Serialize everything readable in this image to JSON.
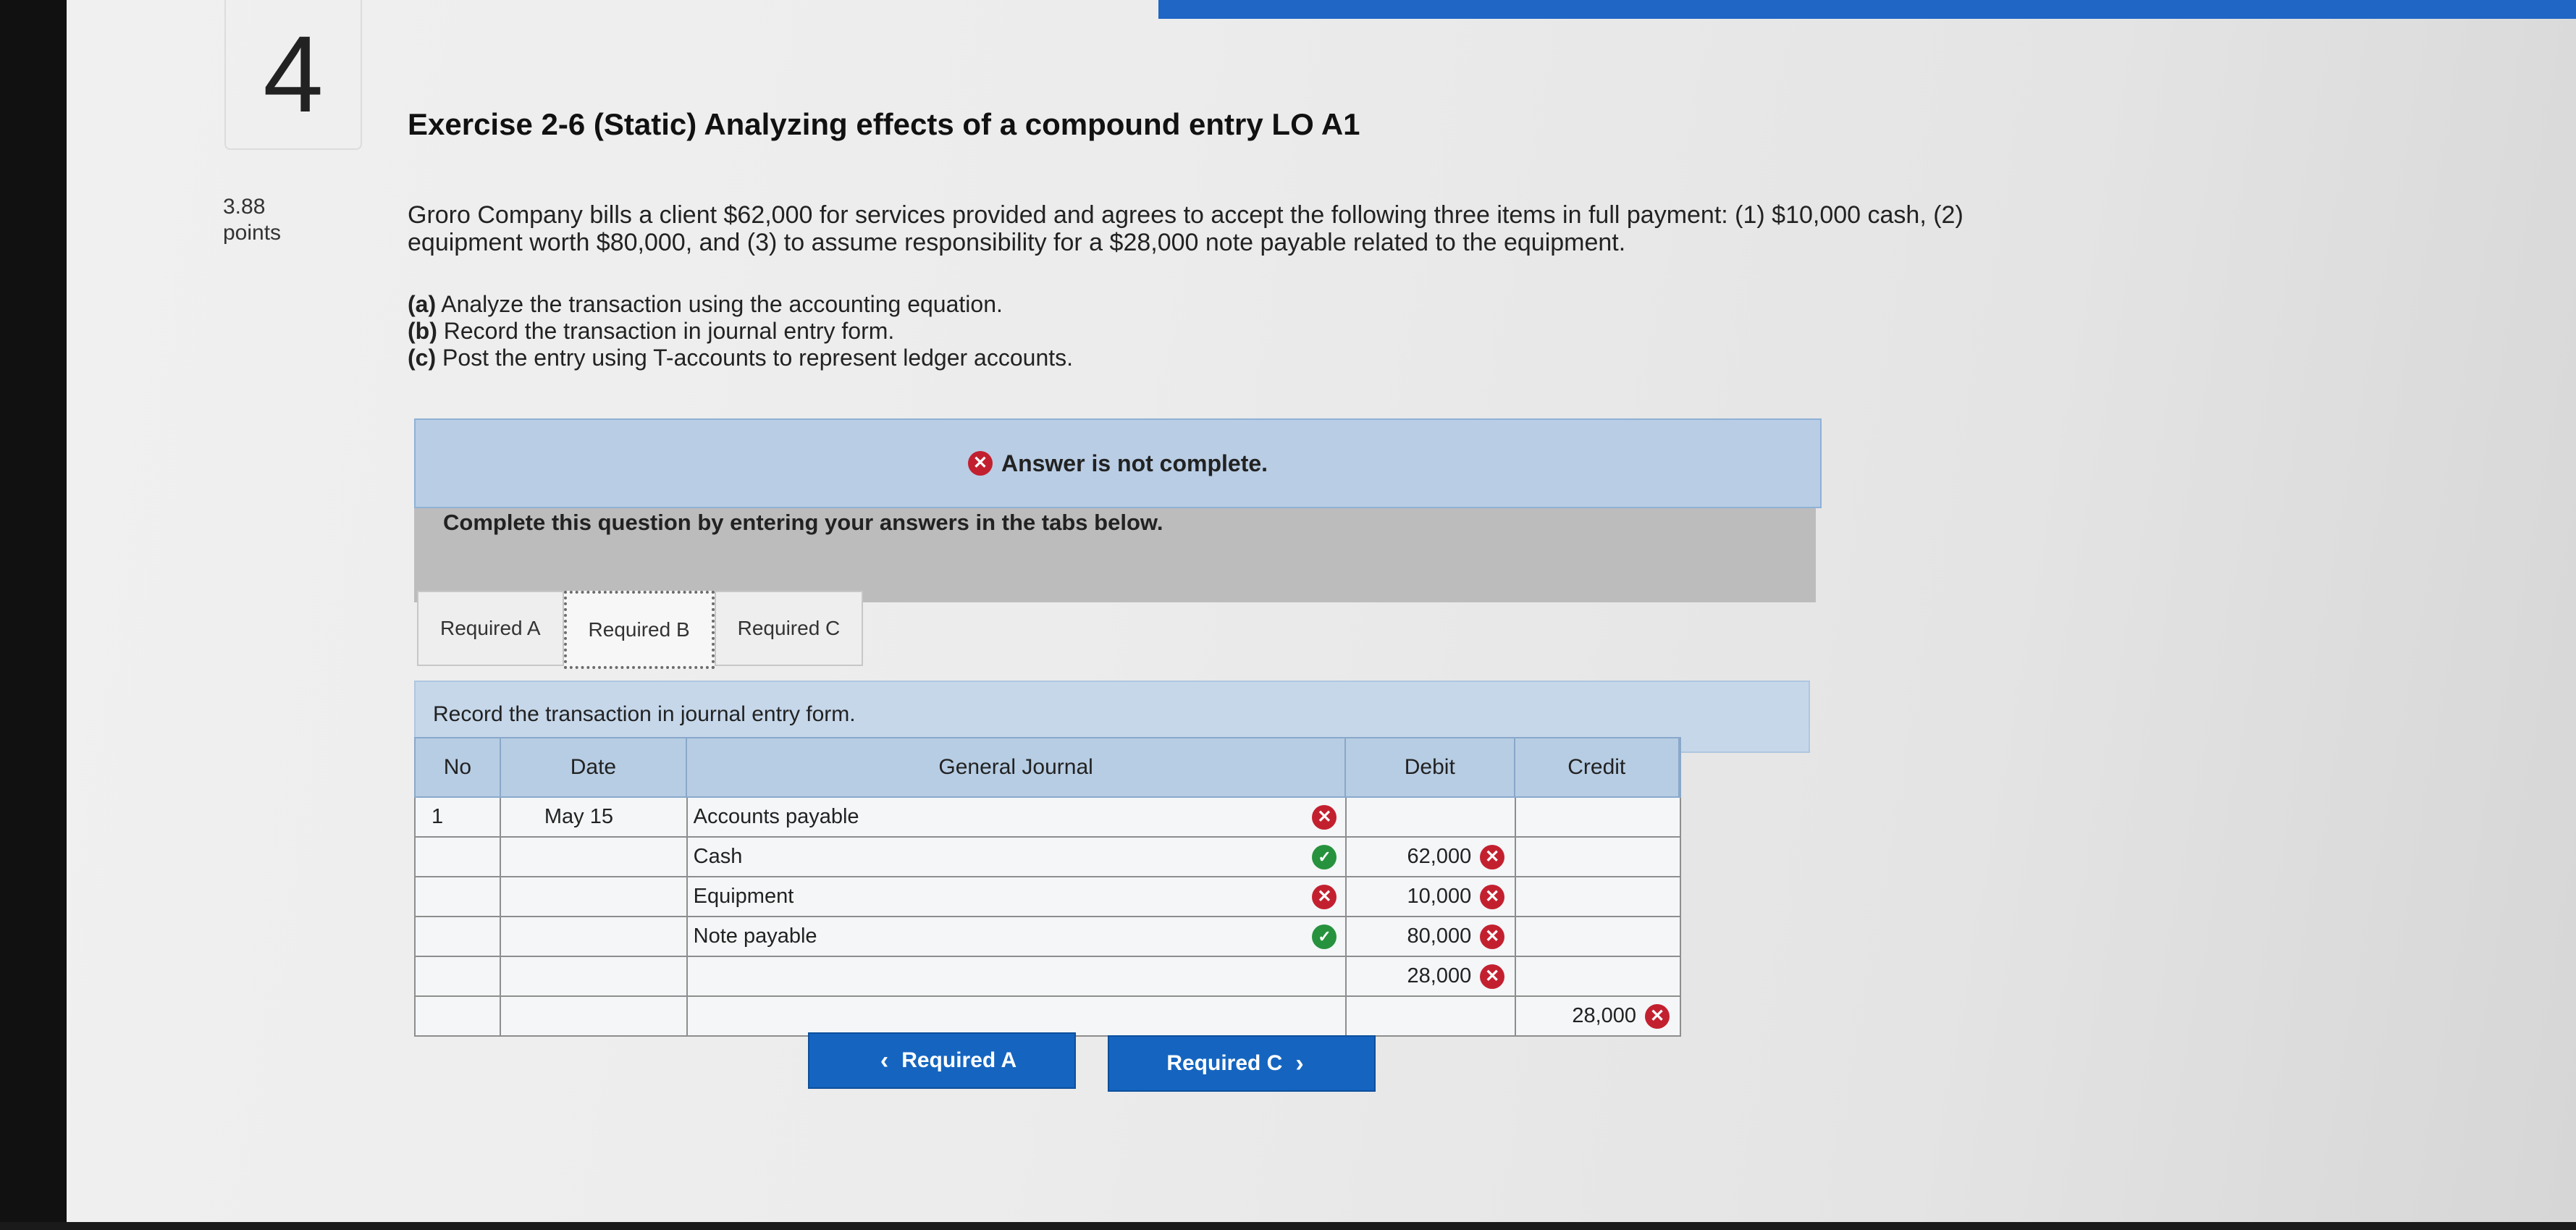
{
  "question": {
    "number": "4",
    "points_value": "3.88",
    "points_label": "points",
    "title": "Exercise 2-6 (Static) Analyzing effects of a compound entry LO A1",
    "description": "Groro Company bills a client $62,000 for services provided and agrees to accept the following three items in full payment: (1) $10,000 cash, (2) equipment worth $80,000, and (3) to assume responsibility for a $28,000 note payable related to the equipment.",
    "requirements": [
      {
        "letter": "(a)",
        "text": "Analyze the transaction using the accounting equation."
      },
      {
        "letter": "(b)",
        "text": "Record the transaction in journal entry form."
      },
      {
        "letter": "(c)",
        "text": "Post the entry using T-accounts to represent ledger accounts."
      }
    ]
  },
  "banner": {
    "text": "Answer is not complete.",
    "icon": "x-circle-icon"
  },
  "instructions": "Complete this question by entering your answers in the tabs below.",
  "tabs": [
    {
      "label": "Required A",
      "active": false
    },
    {
      "label": "Required B",
      "active": true
    },
    {
      "label": "Required C",
      "active": false
    }
  ],
  "panel": {
    "heading": "Record the transaction in journal entry form."
  },
  "journal": {
    "headers": {
      "no": "No",
      "date": "Date",
      "account": "General Journal",
      "debit": "Debit",
      "credit": "Credit"
    },
    "rows": [
      {
        "no": "1",
        "date": "May 15",
        "account": "Accounts payable",
        "account_mark": "x",
        "debit": "",
        "credit": ""
      },
      {
        "no": "",
        "date": "",
        "account": "Cash",
        "account_mark": "check",
        "debit": "62,000",
        "debit_mark": "x",
        "credit": ""
      },
      {
        "no": "",
        "date": "",
        "account": "Equipment",
        "account_mark": "x",
        "debit": "10,000",
        "debit_mark": "x",
        "credit": ""
      },
      {
        "no": "",
        "date": "",
        "account": "Note payable",
        "account_mark": "check",
        "debit": "80,000",
        "debit_mark": "x",
        "credit": ""
      },
      {
        "no": "",
        "date": "",
        "account": "",
        "debit": "28,000",
        "debit_mark": "x",
        "credit": ""
      },
      {
        "no": "",
        "date": "",
        "account": "",
        "debit": "",
        "credit": "28,000",
        "credit_mark": "x"
      }
    ]
  },
  "nav": {
    "prev_label": "Required A",
    "next_label": "Required C"
  },
  "colors": {
    "accent": "#1565c0",
    "error": "#c3202f",
    "success": "#27923d",
    "banner_bg": "#b9cde4"
  }
}
